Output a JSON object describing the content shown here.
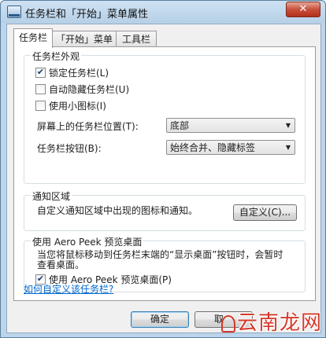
{
  "window": {
    "title": "任务栏和「开始」菜单属性",
    "close_label": "✕"
  },
  "tabs": [
    {
      "label": "任务栏",
      "active": true
    },
    {
      "label": "「开始」菜单",
      "active": false
    },
    {
      "label": "工具栏",
      "active": false
    }
  ],
  "appearance": {
    "title": "任务栏外观",
    "lock": {
      "label": "锁定任务栏(L)",
      "checked": true
    },
    "autohide": {
      "label": "自动隐藏任务栏(U)",
      "checked": false
    },
    "small_icons": {
      "label": "使用小图标(I)",
      "checked": false
    },
    "location_label": "屏幕上的任务栏位置(T):",
    "location_value": "底部",
    "buttons_label": "任务栏按钮(B):",
    "buttons_value": "始终合并、隐藏标签"
  },
  "notification": {
    "title": "通知区域",
    "description": "自定义通知区域中出现的图标和通知。",
    "customize_button": "自定义(C)..."
  },
  "aero_peek": {
    "title": "使用 Aero Peek 预览桌面",
    "description_line1": "当您将鼠标移动到任务栏末端的“显示桌面”按钮时，会暂时",
    "description_line2": "查看桌面。",
    "checkbox": {
      "label": "使用 Aero Peek 预览桌面(P)",
      "checked": true
    }
  },
  "help_link": "如何自定义该任务栏?",
  "footer": {
    "ok_label": "确定",
    "cancel_label": "取"
  },
  "watermark": {
    "text": "云南龙网"
  },
  "check_glyph": "✔",
  "dropdown_glyph": "▼"
}
